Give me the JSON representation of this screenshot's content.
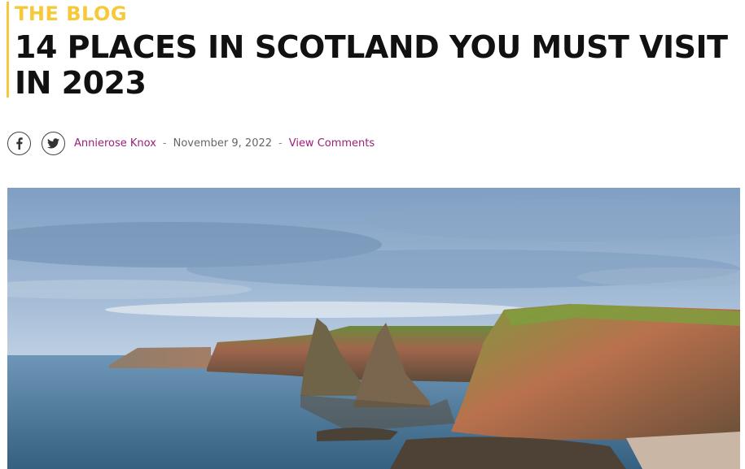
{
  "header": {
    "kicker": "THE BLOG",
    "title": "14 PLACES IN SCOTLAND YOU MUST VISIT IN 2023",
    "accent_color": "#f5c93a"
  },
  "meta": {
    "author": "Annierose Knox",
    "separator": "-",
    "date": "November 9, 2022",
    "comments_link": "View Comments",
    "link_color": "#9a1f79"
  },
  "share": {
    "icons": [
      "facebook-icon",
      "twitter-icon"
    ]
  },
  "hero_image": {
    "subject": "coastal sea cliffs and sea stacks under a blue sky"
  }
}
